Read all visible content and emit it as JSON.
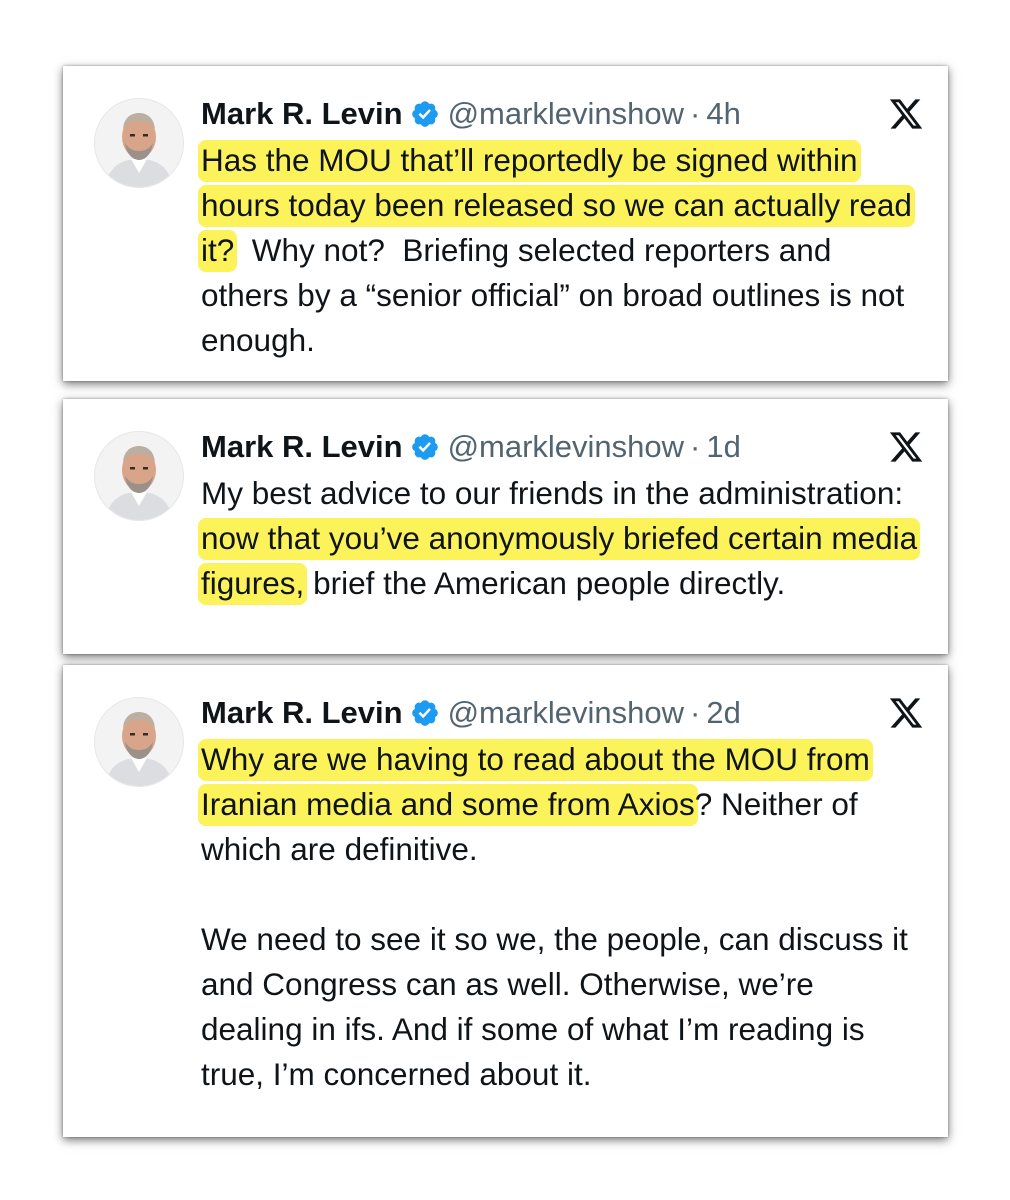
{
  "colors": {
    "highlight": "#fcf25a",
    "verified_badge": "#1d9bf0",
    "handle_gray": "#536471",
    "text": "#0f1419"
  },
  "icons": {
    "verified": "verified-badge-icon",
    "platform": "x-logo-icon"
  },
  "tweets": [
    {
      "author": "Mark R. Levin",
      "handle": "@marklevinshow",
      "separator": "·",
      "time": "4h",
      "paragraphs": [
        {
          "highlighted": "Has the MOU that’ll reportedly be signed within hours today been released so we can actually read it?",
          "after": "  Why not?  Briefing selected reporters and others by a “senior official” on broad outlines is not enough."
        }
      ]
    },
    {
      "author": "Mark R. Levin",
      "handle": "@marklevinshow",
      "separator": "·",
      "time": "1d",
      "paragraphs": [
        {
          "before": "My best advice to our friends in the administration: ",
          "highlighted": "now that you’ve anonymously briefed certain media figures,",
          "after": " brief the American people directly."
        }
      ]
    },
    {
      "author": "Mark R. Levin",
      "handle": "@marklevinshow",
      "separator": "·",
      "time": "2d",
      "paragraphs": [
        {
          "highlighted": "Why are we having to read about the MOU from Iranian media and some from Axios",
          "after": "? Neither of which are definitive."
        },
        {
          "text": "We need to see it so we, the people, can discuss it and Congress can as well. Otherwise, we’re dealing in ifs. And if some of what I’m reading is true, I’m concerned about it."
        }
      ]
    }
  ]
}
